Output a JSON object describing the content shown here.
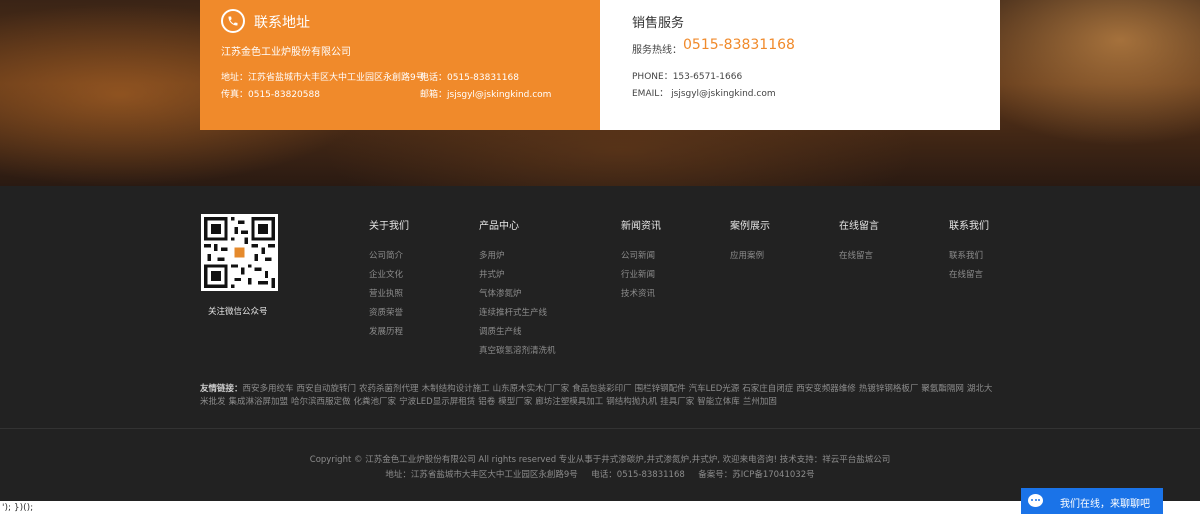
{
  "contact": {
    "title": "联系地址",
    "company": "江苏金色工业炉股份有限公司",
    "address": "地址：江苏省盐城市大丰区大中工业园区永創路9号",
    "tel": "电话：0515-83831168",
    "fax": "传真：0515-83820588",
    "email": "邮箱：jsjsgyl@jskingkind.com"
  },
  "sales": {
    "title": "销售服务",
    "hotline_label": "服务热线：",
    "hotline": "0515-83831168",
    "phone": "PHONE：153-6571-1666",
    "email": "EMAIL：  jsjsgyl@jskingkind.com"
  },
  "wechat": {
    "caption": "关注微信公众号"
  },
  "nav": [
    {
      "title": "关于我们",
      "links": [
        "公司简介",
        "企业文化",
        "营业执照",
        "资质荣誉",
        "发展历程"
      ]
    },
    {
      "title": "产品中心",
      "links": [
        "多用炉",
        "井式炉",
        "气体渗氮炉",
        "连续推杆式生产线",
        "调质生产线",
        "真空碳氢溶剂清洗机"
      ]
    },
    {
      "title": "新闻资讯",
      "links": [
        "公司新闻",
        "行业新闻",
        "技术资讯"
      ]
    },
    {
      "title": "案例展示",
      "links": [
        "应用案例"
      ]
    },
    {
      "title": "在线留言",
      "links": [
        "在线留言"
      ]
    },
    {
      "title": "联系我们",
      "links": [
        "联系我们",
        "在线留言"
      ]
    }
  ],
  "friends": {
    "label": "友情链接：",
    "links": [
      "西安多用绞车",
      "西安自动旋转门",
      "农药杀菌剂代理",
      "木制结构设计施工",
      "山东原木实木门厂家",
      "食品包装彩印厂",
      "围栏锌钢配件",
      "汽车LED光源",
      "石家庄自闭症",
      "西安变频器维修",
      "热镀锌钢格板厂",
      "聚氨酯隔网",
      "湖北大米批发",
      "集成淋浴屏加盟",
      "哈尔滨西服定做",
      "化粪池厂家",
      "宁波LED显示屏租赁",
      "铝卷",
      "模型厂家",
      "廊坊注塑模具加工",
      "钢结构抛丸机",
      "挂具厂家",
      "智能立体库",
      "兰州加固"
    ]
  },
  "copyright": {
    "line1": "Copyright © 江苏金色工业炉股份有限公司 All rights reserved 专业从事于井式渗碳炉,井式渗氮炉,井式炉, 欢迎来电咨询! 技术支持：祥云平台盐城公司",
    "line2": "地址：江苏省盐城市大丰区大中工业园区永創路9号     电话：0515-83831168     备案号：苏ICP备17041032号"
  },
  "bottom_text": "'); })();",
  "chat": {
    "label": "我们在线，来聊聊吧"
  }
}
